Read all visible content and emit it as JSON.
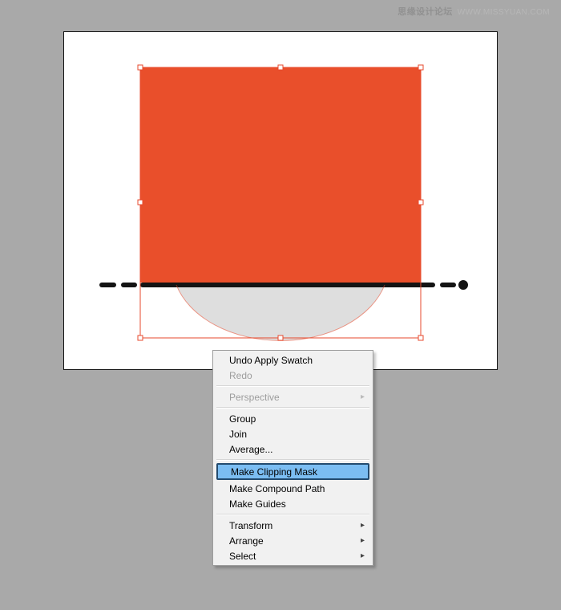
{
  "watermark": {
    "main": "思缘设计论坛",
    "sub": "WWW.MISSYUAN.COM"
  },
  "canvas": {
    "rect_fill": "#e94f2b",
    "selection_stroke": "#e74a2d",
    "arc_fill": "#dedede",
    "line_stroke": "#141414"
  },
  "menu": {
    "undo": "Undo Apply Swatch",
    "redo": "Redo",
    "perspective": "Perspective",
    "group": "Group",
    "join": "Join",
    "average": "Average...",
    "make_clip": "Make Clipping Mask",
    "make_compound": "Make Compound Path",
    "make_guides": "Make Guides",
    "transform": "Transform",
    "arrange": "Arrange",
    "select": "Select"
  }
}
